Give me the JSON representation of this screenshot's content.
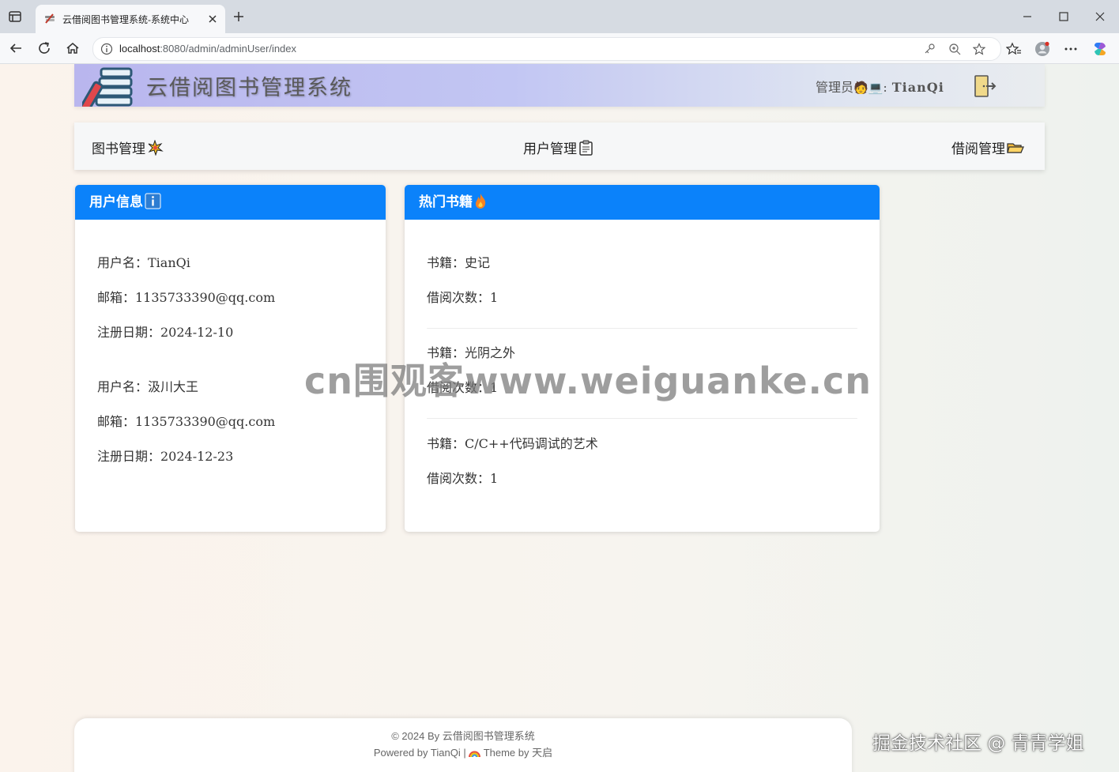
{
  "browser": {
    "tab_title": "云借阅图书管理系统-系统中心",
    "url_host": "localhost",
    "url_rest": ":8080/admin/adminUser/index"
  },
  "header": {
    "site_title": "云借阅图书管理系统",
    "admin_label": "管理员",
    "admin_emoji": "🧑💻",
    "admin_sep": ":",
    "admin_name": "TianQi"
  },
  "nav": {
    "items": [
      {
        "label": "图书管理",
        "icon": "sparkle-icon"
      },
      {
        "label": "用户管理",
        "icon": "clipboard-icon"
      },
      {
        "label": "借阅管理",
        "icon": "folder-icon"
      }
    ]
  },
  "user_card": {
    "title": "用户信息",
    "users": [
      {
        "username_label": "用户名：TianQi",
        "email_label": "邮箱：1135733390@qq.com",
        "date_label": "注册日期：2024-12-10"
      },
      {
        "username_label": "用户名：汲川大王",
        "email_label": "邮箱：1135733390@qq.com",
        "date_label": "注册日期：2024-12-23"
      }
    ]
  },
  "book_card": {
    "title": "热门书籍",
    "books": [
      {
        "name_label": "书籍：史记",
        "count_label": "借阅次数：1"
      },
      {
        "name_label": "书籍：光阴之外",
        "count_label": "借阅次数：1"
      },
      {
        "name_label": "书籍：C/C++代码调试的艺术",
        "count_label": "借阅次数：1"
      }
    ]
  },
  "watermark": "cn围观客www.weiguanke.cn",
  "footer": {
    "line1": "© 2024 By 云借阅图书管理系统",
    "line2_a": "Powered by TianQi | ",
    "line2_b": " Theme by 天启"
  },
  "corner_mark": "掘金技术社区 @ 青青学姐",
  "colors": {
    "accent": "#0b82fa",
    "header_start": "#b9b6ee",
    "header_end": "#e9ecef"
  }
}
